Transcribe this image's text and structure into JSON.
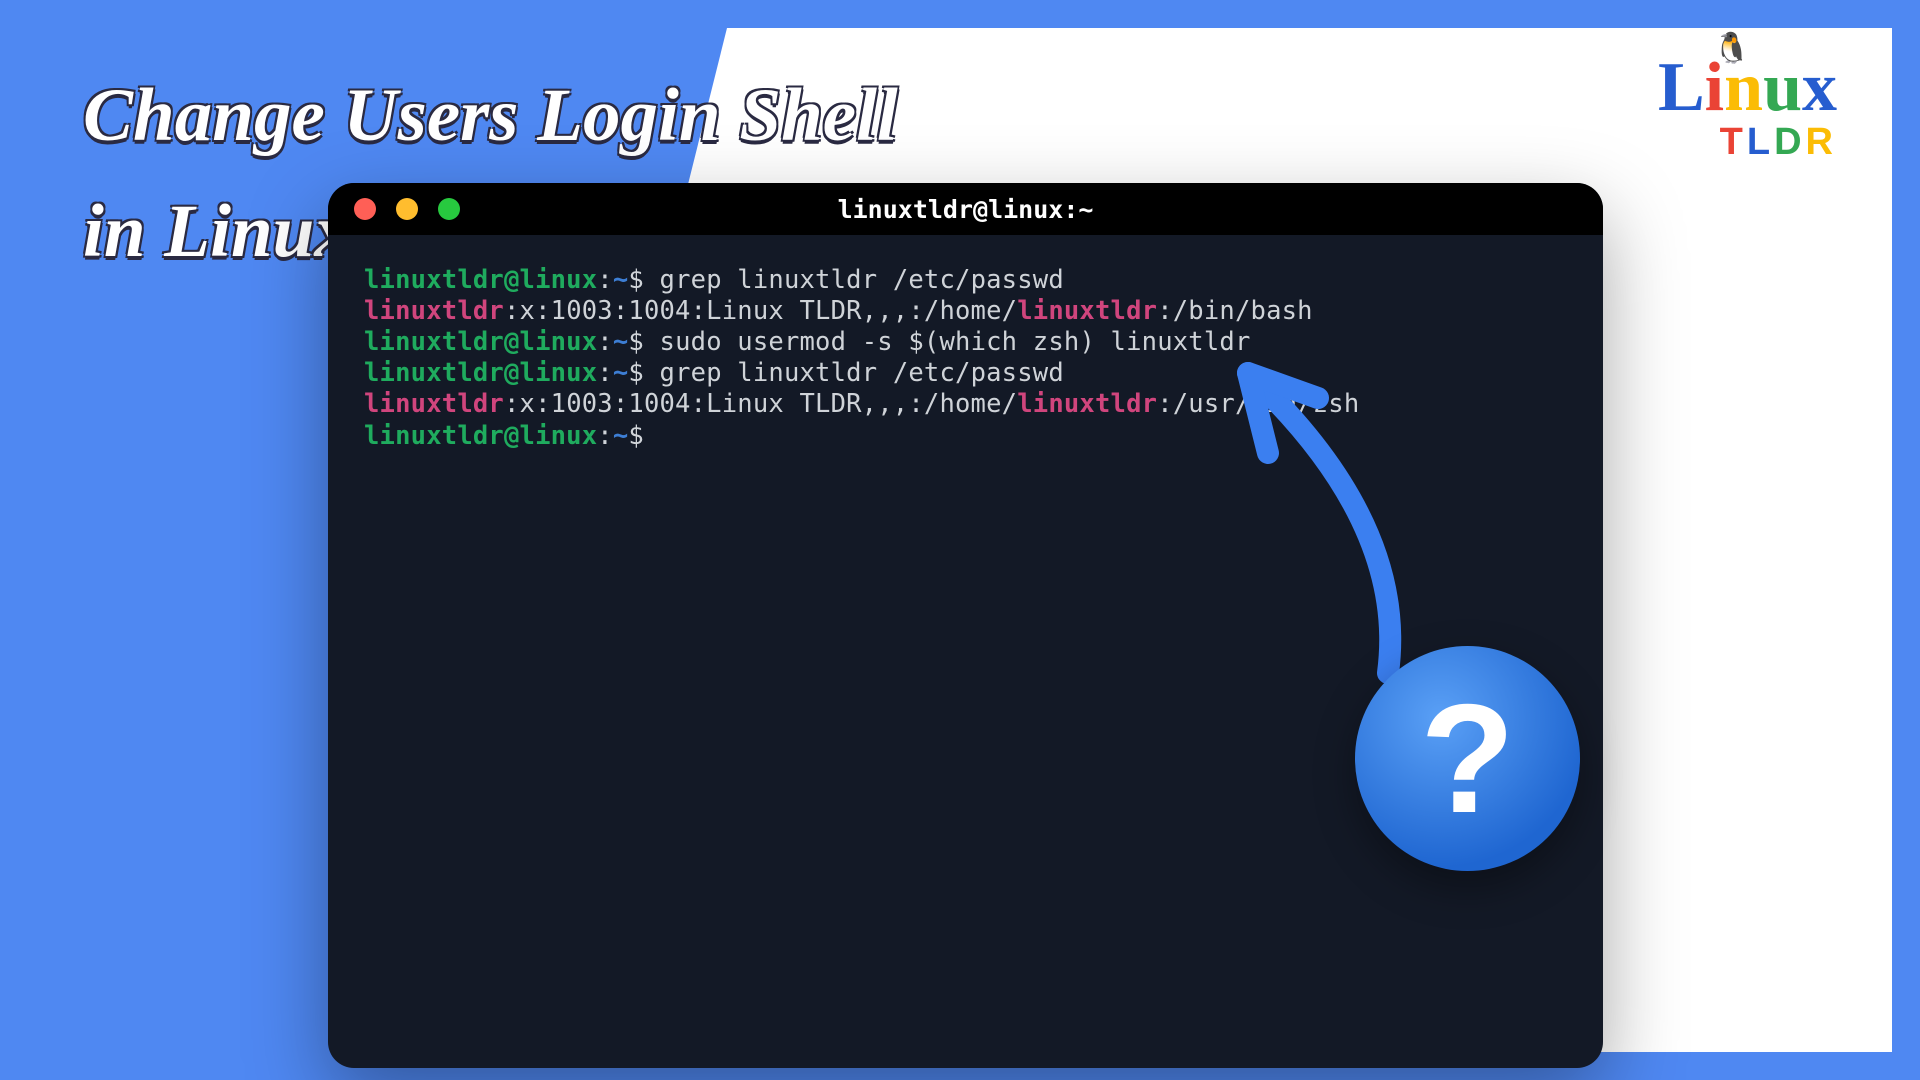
{
  "headline": "Change Users Login Shell\nin Linux",
  "logo": {
    "chars": {
      "L": "L",
      "i": "i",
      "n": "n",
      "u": "u",
      "x": "x"
    },
    "tldr_chars": {
      "T": "T",
      "L": "L",
      "D": "D",
      "R": "R"
    }
  },
  "colors": {
    "blue_bg": "#4f88f2",
    "term_bg": "#131926",
    "prompt_host": "#1fab5e",
    "prompt_path": "#3d7ed4",
    "highlight_user": "#d0457d",
    "logo_L": "#265dcf",
    "logo_i": "#ea4335",
    "logo_n": "#fbbc05",
    "logo_u": "#34a853",
    "logo_x": "#265dcf",
    "tldr_T": "#ea4335",
    "tldr_L": "#265dcf",
    "tldr_D": "#34a853",
    "tldr_R": "#fbbc05"
  },
  "terminal": {
    "title": "linuxtldr@linux:~",
    "prompt": {
      "host": "linuxtldr@linux",
      "sep": ":",
      "path": "~",
      "sym": "$ "
    },
    "lines": [
      {
        "type": "cmd",
        "text": "grep linuxtldr /etc/passwd"
      },
      {
        "type": "out",
        "segments": [
          {
            "style": "out-user",
            "text": "linuxtldr"
          },
          {
            "style": "out-plain",
            "text": ":x:1003:1004:Linux TLDR,,,:/home/"
          },
          {
            "style": "out-user",
            "text": "linuxtldr"
          },
          {
            "style": "out-plain",
            "text": ":/bin/bash"
          }
        ]
      },
      {
        "type": "cmd",
        "text": "sudo usermod -s $(which zsh) linuxtldr"
      },
      {
        "type": "cmd",
        "text": "grep linuxtldr /etc/passwd"
      },
      {
        "type": "out",
        "segments": [
          {
            "style": "out-user",
            "text": "linuxtldr"
          },
          {
            "style": "out-plain",
            "text": ":x:1003:1004:Linux TLDR,,,:/home/"
          },
          {
            "style": "out-user",
            "text": "linuxtldr"
          },
          {
            "style": "out-plain",
            "text": ":/usr/bin/zsh"
          }
        ]
      },
      {
        "type": "cmd",
        "text": ""
      }
    ]
  },
  "badge": {
    "symbol": "?"
  }
}
